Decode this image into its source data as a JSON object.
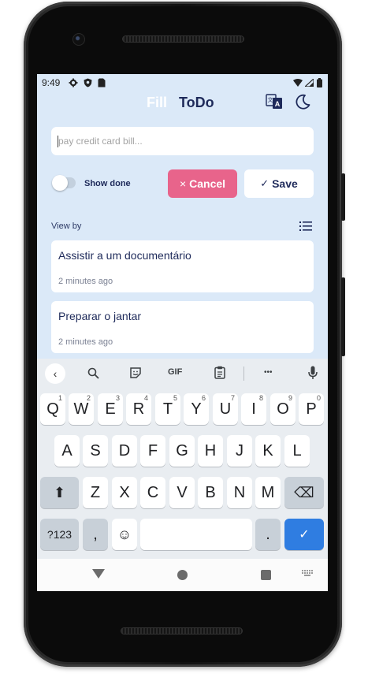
{
  "status_bar": {
    "time": "9:49",
    "left_icons": [
      "gear-icon",
      "shield-icon",
      "sim-icon"
    ],
    "right_icons": [
      "wifi-icon",
      "signal-icon",
      "battery-icon"
    ]
  },
  "app_bar": {
    "title_part1": "Fill",
    "title_part2": "ToDo",
    "title_part1_color": "#ffffff",
    "title_part2_color": "#1e2a5a"
  },
  "todo_input": {
    "value": "",
    "placeholder": "pay credit card bill..."
  },
  "controls": {
    "show_done_label": "Show done",
    "show_done_on": false,
    "cancel_label": "Cancel",
    "cancel_symbol": "×",
    "save_label": "Save",
    "save_symbol": "✓",
    "cancel_color": "#e8648b"
  },
  "list": {
    "view_by_label": "View by",
    "items": [
      {
        "title": "Assistir a um documentário",
        "time": "2 minutes ago"
      },
      {
        "title": "Preparar o jantar",
        "time": "2 minutes ago"
      }
    ]
  },
  "keyboard": {
    "toolbar": {
      "back": "‹",
      "gif": "GIF",
      "more": "•••"
    },
    "row1": [
      {
        "key": "Q",
        "num": "1"
      },
      {
        "key": "W",
        "num": "2"
      },
      {
        "key": "E",
        "num": "3"
      },
      {
        "key": "R",
        "num": "4"
      },
      {
        "key": "T",
        "num": "5"
      },
      {
        "key": "Y",
        "num": "6"
      },
      {
        "key": "U",
        "num": "7"
      },
      {
        "key": "I",
        "num": "8"
      },
      {
        "key": "O",
        "num": "9"
      },
      {
        "key": "P",
        "num": "0"
      }
    ],
    "row2": [
      "A",
      "S",
      "D",
      "F",
      "G",
      "H",
      "J",
      "K",
      "L"
    ],
    "row3": [
      "Z",
      "X",
      "C",
      "V",
      "B",
      "N",
      "M"
    ],
    "symbols_key": "?123",
    "comma_key": ",",
    "emoji_key": "☺",
    "period_key": ".",
    "shift_symbol": "⬆",
    "backspace_symbol": "⌫",
    "enter_symbol": "✓",
    "enter_color": "#2f7de1"
  }
}
